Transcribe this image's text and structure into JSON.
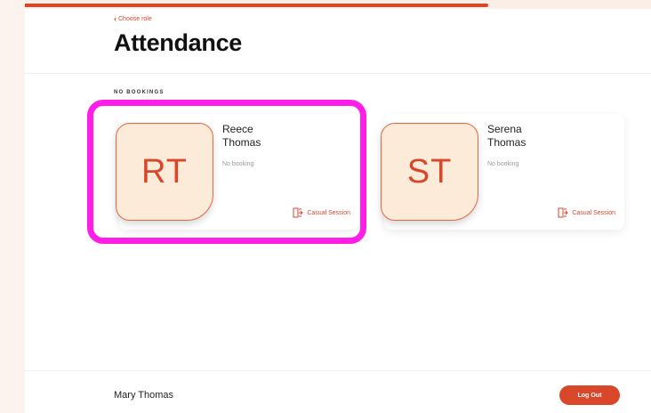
{
  "header": {
    "progress_fraction": 0.74,
    "back_label": "Choose role",
    "title": "Attendance"
  },
  "section": {
    "label": "NO BOOKINGS"
  },
  "cards": [
    {
      "initials": "RT",
      "name_first": "Reece",
      "name_last": "Thomas",
      "status": "No booking",
      "action_label": "Casual Session",
      "action_icon": "door-enter-icon"
    },
    {
      "initials": "ST",
      "name_first": "Serena",
      "name_last": "Thomas",
      "status": "No booking",
      "action_label": "Casual Session",
      "action_icon": "door-enter-icon"
    }
  ],
  "footer": {
    "user_name": "Mary Thomas",
    "logout_label": "Log Out"
  },
  "colors": {
    "accent": "#d9472b",
    "avatar_bg": "#fcebd9",
    "highlight": "#ff1ee8",
    "page_bg": "#fdf3ee"
  }
}
